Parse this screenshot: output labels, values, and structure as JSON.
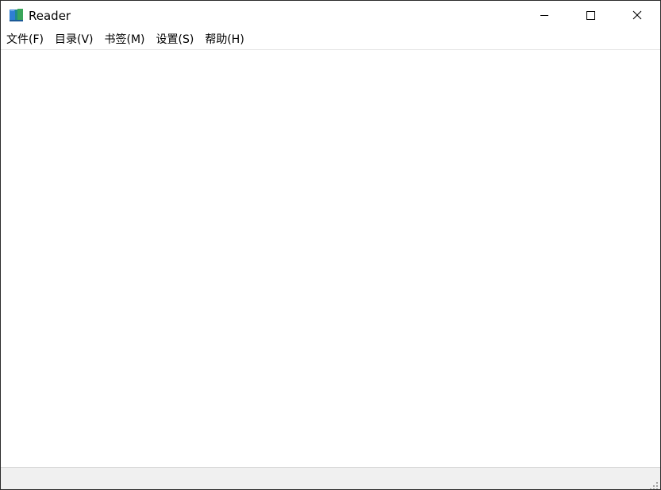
{
  "window": {
    "title": "Reader",
    "app_icon": "book-icon",
    "controls": {
      "minimize_icon": "minimize-icon",
      "maximize_icon": "maximize-icon",
      "close_icon": "close-icon"
    }
  },
  "menu": {
    "items": [
      {
        "label": "文件(F)"
      },
      {
        "label": "目录(V)"
      },
      {
        "label": "书签(M)"
      },
      {
        "label": "设置(S)"
      },
      {
        "label": "帮助(H)"
      }
    ]
  },
  "statusbar": {
    "grip_icon": "resize-grip-icon"
  },
  "colors": {
    "statusbar_bg": "#f0f0f0",
    "window_border": "#2b2b2b",
    "icon_blue": "#2f7fd3",
    "icon_green": "#3aa55a",
    "icon_teal": "#1f8a8a"
  }
}
